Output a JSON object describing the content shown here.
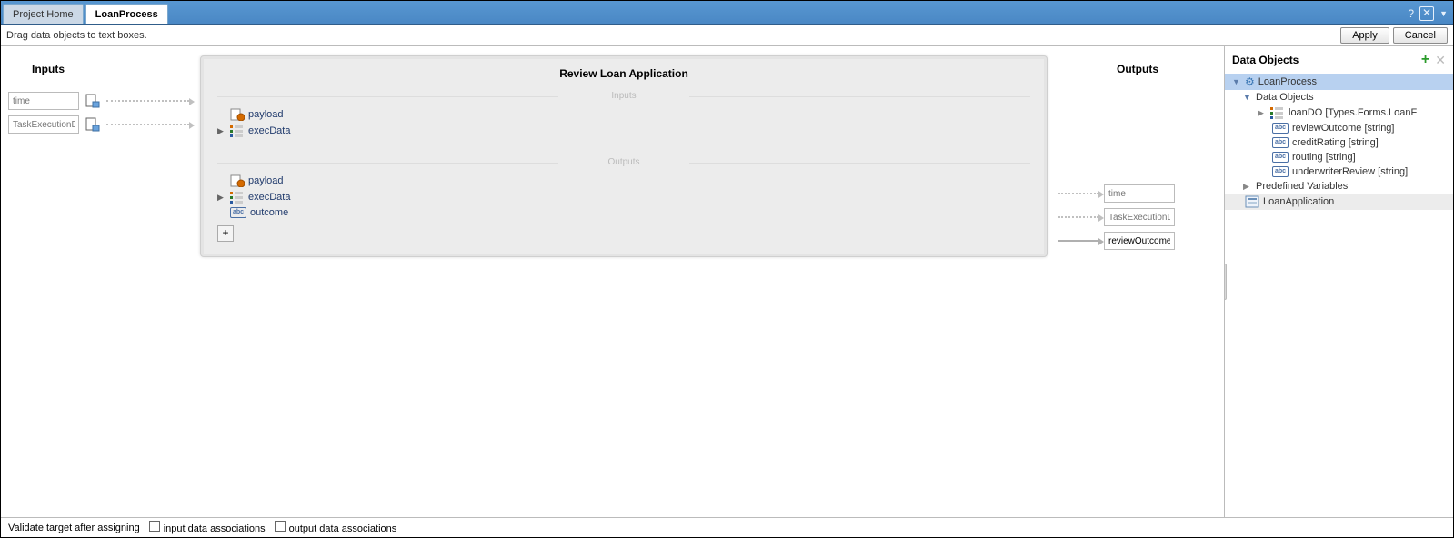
{
  "tabs": {
    "project_home": "Project Home",
    "loan_process": "LoanProcess"
  },
  "toolbar": {
    "hint": "Drag data objects to text boxes.",
    "apply": "Apply",
    "cancel": "Cancel"
  },
  "headers": {
    "inputs": "Inputs",
    "outputs": "Outputs",
    "center_title": "Review Loan Application",
    "inputs_fs": "Inputs",
    "outputs_fs": "Outputs",
    "data_objects": "Data Objects"
  },
  "inputs": [
    {
      "placeholder": "time"
    },
    {
      "placeholder": "TaskExecutionDa"
    }
  ],
  "center_inputs": [
    {
      "label": "payload",
      "kind": "struct",
      "expandable": false
    },
    {
      "label": "execData",
      "kind": "struct",
      "expandable": true
    }
  ],
  "center_outputs": [
    {
      "label": "payload",
      "kind": "struct",
      "expandable": false
    },
    {
      "label": "execData",
      "kind": "struct",
      "expandable": true
    },
    {
      "label": "outcome",
      "kind": "abc",
      "expandable": false
    }
  ],
  "outputs": [
    {
      "placeholder": "time",
      "arrow": "dashed"
    },
    {
      "placeholder": "TaskExecutionDa",
      "arrow": "dashed"
    },
    {
      "value": "reviewOutcome",
      "arrow": "solid"
    }
  ],
  "tree": {
    "root": "LoanProcess",
    "data_objects_label": "Data Objects",
    "items": [
      {
        "label": "loanDO [Types.Forms.LoanF",
        "kind": "struct",
        "expandable": true
      },
      {
        "label": "reviewOutcome [string]",
        "kind": "abc"
      },
      {
        "label": "creditRating [string]",
        "kind": "abc"
      },
      {
        "label": "routing [string]",
        "kind": "abc"
      },
      {
        "label": "underwriterReview [string]",
        "kind": "abc"
      }
    ],
    "predefined_label": "Predefined Variables",
    "loan_app": "LoanApplication"
  },
  "footer": {
    "validate": "Validate target after assigning",
    "input_assoc": "input data associations",
    "output_assoc": "output data associations"
  }
}
